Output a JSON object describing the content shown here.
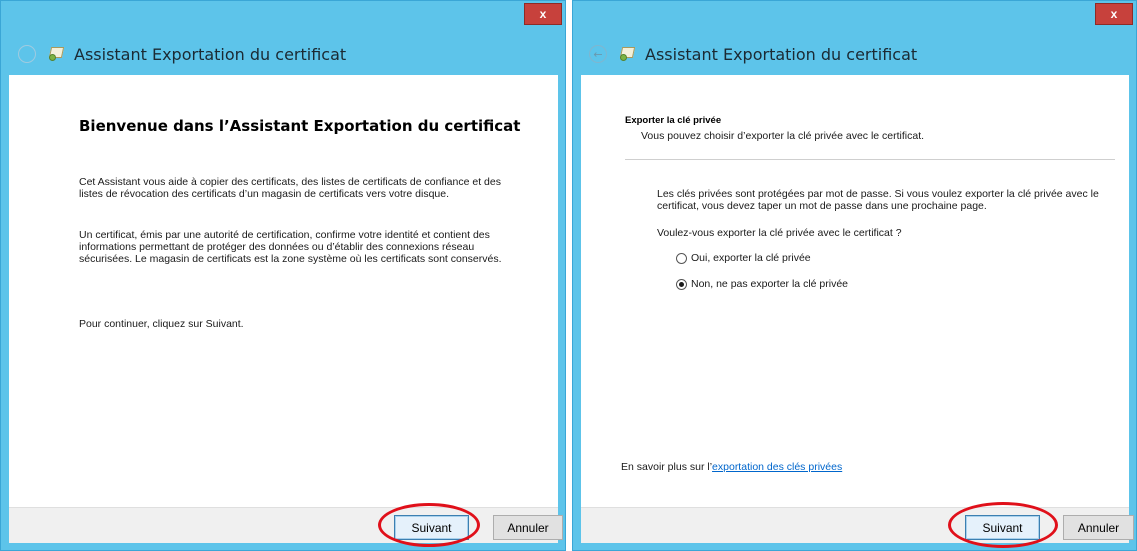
{
  "windows": {
    "left": {
      "close_glyph": "x",
      "back_glyph": "",
      "title": "Assistant Exportation du certificat",
      "heading": "Bienvenue dans l’Assistant Exportation du certificat",
      "paragraphs": [
        "Cet Assistant vous aide à copier des certificats, des listes de certificats de confiance et des listes de révocation des certificats d’un magasin de certificats vers votre disque.",
        "Un certificat, émis par une autorité de certification, confirme votre identité et contient des informations permettant de protéger des données ou d’établir des connexions réseau sécurisées. Le magasin de certificats est la zone système où les certificats sont conservés.",
        "Pour continuer, cliquez sur Suivant."
      ],
      "next_label": "Suivant",
      "cancel_label": "Annuler"
    },
    "right": {
      "close_glyph": "x",
      "back_glyph": "←",
      "title": "Assistant Exportation du certificat",
      "section_title": "Exporter la clé privée",
      "section_subtitle": "Vous pouvez choisir d’exporter la clé privée avec le certificat.",
      "info": "Les clés privées sont protégées par mot de passe. Si vous voulez exporter la clé privée avec le certificat, vous devez taper un mot de passe dans une prochaine page.",
      "question": "Voulez-vous exporter la clé privée avec le certificat ?",
      "options": [
        {
          "label": "Oui, exporter la clé privée",
          "selected": false
        },
        {
          "label": "Non, ne pas exporter la clé privée",
          "selected": true
        }
      ],
      "learn_more_prefix": "En savoir plus sur l’",
      "learn_more_link": "exportation des clés privées",
      "next_label": "Suivant",
      "cancel_label": "Annuler"
    }
  },
  "colors": {
    "titlebar": "#5dc4ea",
    "close_button": "#c7413c",
    "highlight_ellipse": "#e0101a",
    "link": "#0066cc"
  },
  "icons": {
    "back": "back-arrow-icon",
    "certificate": "certificate-icon",
    "close": "close-icon"
  }
}
